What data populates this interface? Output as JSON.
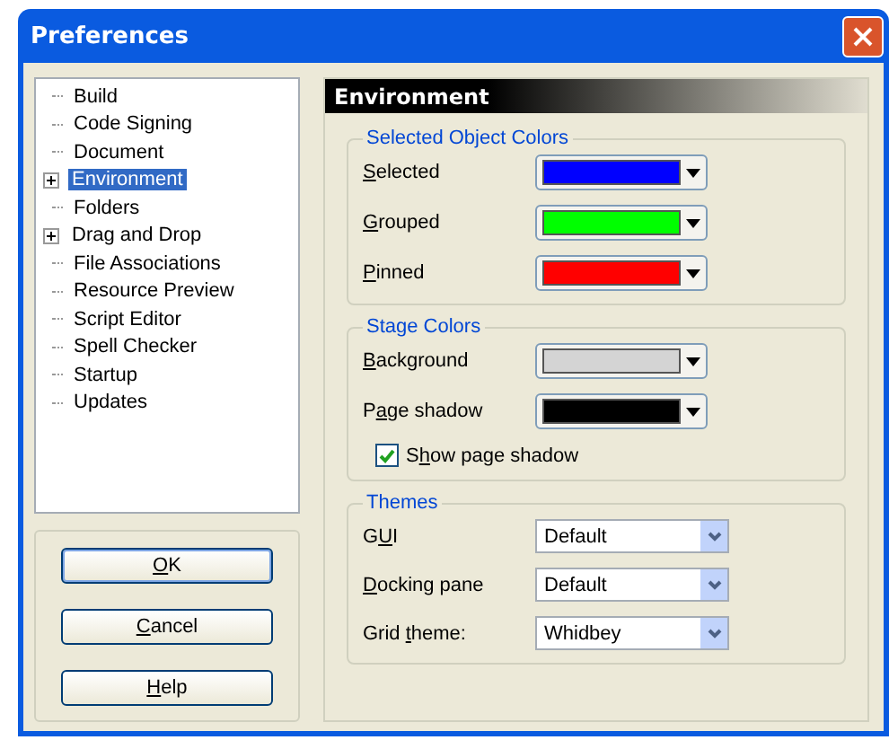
{
  "window": {
    "title": "Preferences"
  },
  "tree": [
    {
      "label": "Build",
      "expandable": false,
      "selected": false
    },
    {
      "label": "Code Signing",
      "expandable": false,
      "selected": false
    },
    {
      "label": "Document",
      "expandable": false,
      "selected": false
    },
    {
      "label": "Environment",
      "expandable": true,
      "selected": true
    },
    {
      "label": "Folders",
      "expandable": false,
      "selected": false
    },
    {
      "label": "Drag and Drop",
      "expandable": true,
      "selected": false
    },
    {
      "label": "File Associations",
      "expandable": false,
      "selected": false
    },
    {
      "label": "Resource Preview",
      "expandable": false,
      "selected": false
    },
    {
      "label": "Script Editor",
      "expandable": false,
      "selected": false
    },
    {
      "label": "Spell Checker",
      "expandable": false,
      "selected": false
    },
    {
      "label": "Startup",
      "expandable": false,
      "selected": false
    },
    {
      "label": "Updates",
      "expandable": false,
      "selected": false
    }
  ],
  "buttons": [
    {
      "label": [
        {
          "text": "O",
          "underlined": true
        },
        {
          "text": "K",
          "underlined": false
        }
      ],
      "default": true
    },
    {
      "label": [
        {
          "text": "C",
          "underlined": true
        },
        {
          "text": "ancel",
          "underlined": false
        }
      ],
      "default": false
    },
    {
      "label": [
        {
          "text": "H",
          "underlined": true
        },
        {
          "text": "elp",
          "underlined": false
        }
      ],
      "default": false
    }
  ],
  "page_title": "Environment",
  "groups": [
    {
      "title": "Selected Object Colors",
      "rows": [
        {
          "kind": "color",
          "label": [
            {
              "text": "S",
              "underlined": true
            },
            {
              "text": "elected",
              "underlined": false
            }
          ],
          "color": "#0000ff"
        },
        {
          "kind": "color",
          "label": [
            {
              "text": "G",
              "underlined": true
            },
            {
              "text": "rouped",
              "underlined": false
            }
          ],
          "color": "#00ff00"
        },
        {
          "kind": "color",
          "label": [
            {
              "text": "P",
              "underlined": true
            },
            {
              "text": "inned",
              "underlined": false
            }
          ],
          "color": "#ff0000"
        }
      ]
    },
    {
      "title": "Stage Colors",
      "rows": [
        {
          "kind": "color",
          "label": [
            {
              "text": "B",
              "underlined": true
            },
            {
              "text": "ackground",
              "underlined": false
            }
          ],
          "color": "#d4d4d4"
        },
        {
          "kind": "color",
          "label": [
            {
              "text": "P",
              "underlined": false
            },
            {
              "text": "a",
              "underlined": true
            },
            {
              "text": "ge shadow",
              "underlined": false
            }
          ],
          "color": "#000000"
        },
        {
          "kind": "checkbox",
          "label": [
            {
              "text": "S",
              "underlined": false
            },
            {
              "text": "h",
              "underlined": true
            },
            {
              "text": "ow page shadow",
              "underlined": false
            }
          ],
          "checked": true
        }
      ]
    },
    {
      "title": "Themes",
      "rows": [
        {
          "kind": "select",
          "label": [
            {
              "text": "G",
              "underlined": false
            },
            {
              "text": "U",
              "underlined": true
            },
            {
              "text": "I",
              "underlined": false
            }
          ],
          "value": "Default"
        },
        {
          "kind": "select",
          "label": [
            {
              "text": "D",
              "underlined": true
            },
            {
              "text": "ocking pane",
              "underlined": false
            }
          ],
          "value": "Default"
        },
        {
          "kind": "select",
          "label": [
            {
              "text": "Grid ",
              "underlined": false
            },
            {
              "text": "t",
              "underlined": true
            },
            {
              "text": "heme:",
              "underlined": false
            }
          ],
          "value": "Whidbey"
        }
      ]
    }
  ]
}
